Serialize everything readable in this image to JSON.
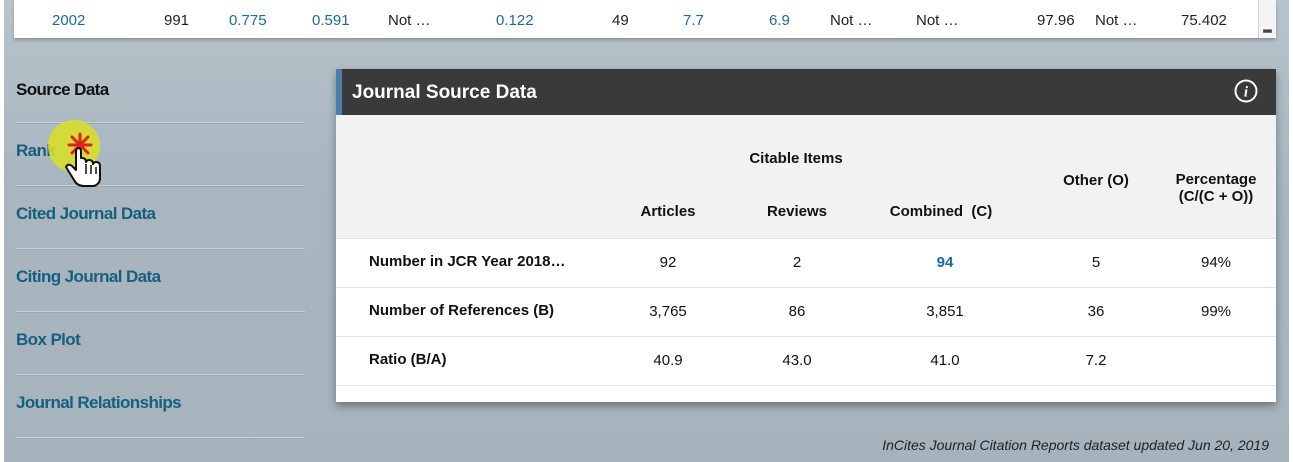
{
  "top_row": {
    "cells": [
      {
        "text": "2002",
        "link": true
      },
      {
        "text": "991",
        "link": false
      },
      {
        "text": "0.775",
        "link": true
      },
      {
        "text": "0.591",
        "link": true
      },
      {
        "text": "Not …",
        "link": false
      },
      {
        "text": "0.122",
        "link": true
      },
      {
        "text": "49",
        "link": false
      },
      {
        "text": "7.7",
        "link": true
      },
      {
        "text": "6.9",
        "link": true
      },
      {
        "text": "Not …",
        "link": false
      },
      {
        "text": "Not …",
        "link": false
      },
      {
        "text": "97.96",
        "link": false
      },
      {
        "text": "Not …",
        "link": false
      },
      {
        "text": "75.402",
        "link": false
      }
    ]
  },
  "sidebar": {
    "items": [
      {
        "label": "Source Data",
        "current": true
      },
      {
        "label": "Rank",
        "current": false
      },
      {
        "label": "Cited Journal Data",
        "current": false
      },
      {
        "label": "Citing Journal Data",
        "current": false
      },
      {
        "label": "Box Plot",
        "current": false
      },
      {
        "label": "Journal Relationships",
        "current": false
      }
    ]
  },
  "panel": {
    "title": "Journal Source Data",
    "headers": {
      "citable_items": "Citable Items",
      "articles": "Articles",
      "reviews": "Reviews",
      "combined": "Combined  (C)",
      "other": "Other (O)",
      "percentage_line1": "Percentage",
      "percentage_line2": "(C/(C + O))"
    },
    "rows": [
      {
        "label": "Number in JCR Year 2018…",
        "articles": "92",
        "reviews": "2",
        "combined": "94",
        "other": "5",
        "percentage": "94%"
      },
      {
        "label": "Number of References (B)",
        "articles": "3,765",
        "reviews": "86",
        "combined": "3,851",
        "other": "36",
        "percentage": "99%"
      },
      {
        "label": "Ratio (B/A)",
        "articles": "40.9",
        "reviews": "43.0",
        "combined": "41.0",
        "other": "7.2",
        "percentage": ""
      }
    ]
  },
  "footer": "InCites Journal Citation Reports dataset updated Jun 20, 2019",
  "icons": {
    "info": "info-icon",
    "cursor": "hand-pointer-icon",
    "scroll": "scroll-down-icon"
  },
  "colors": {
    "link": "#1a6a9a",
    "header_bar": "#3a3a3a",
    "cursor_highlight": "#d9e021",
    "click_star": "#e0221c"
  }
}
